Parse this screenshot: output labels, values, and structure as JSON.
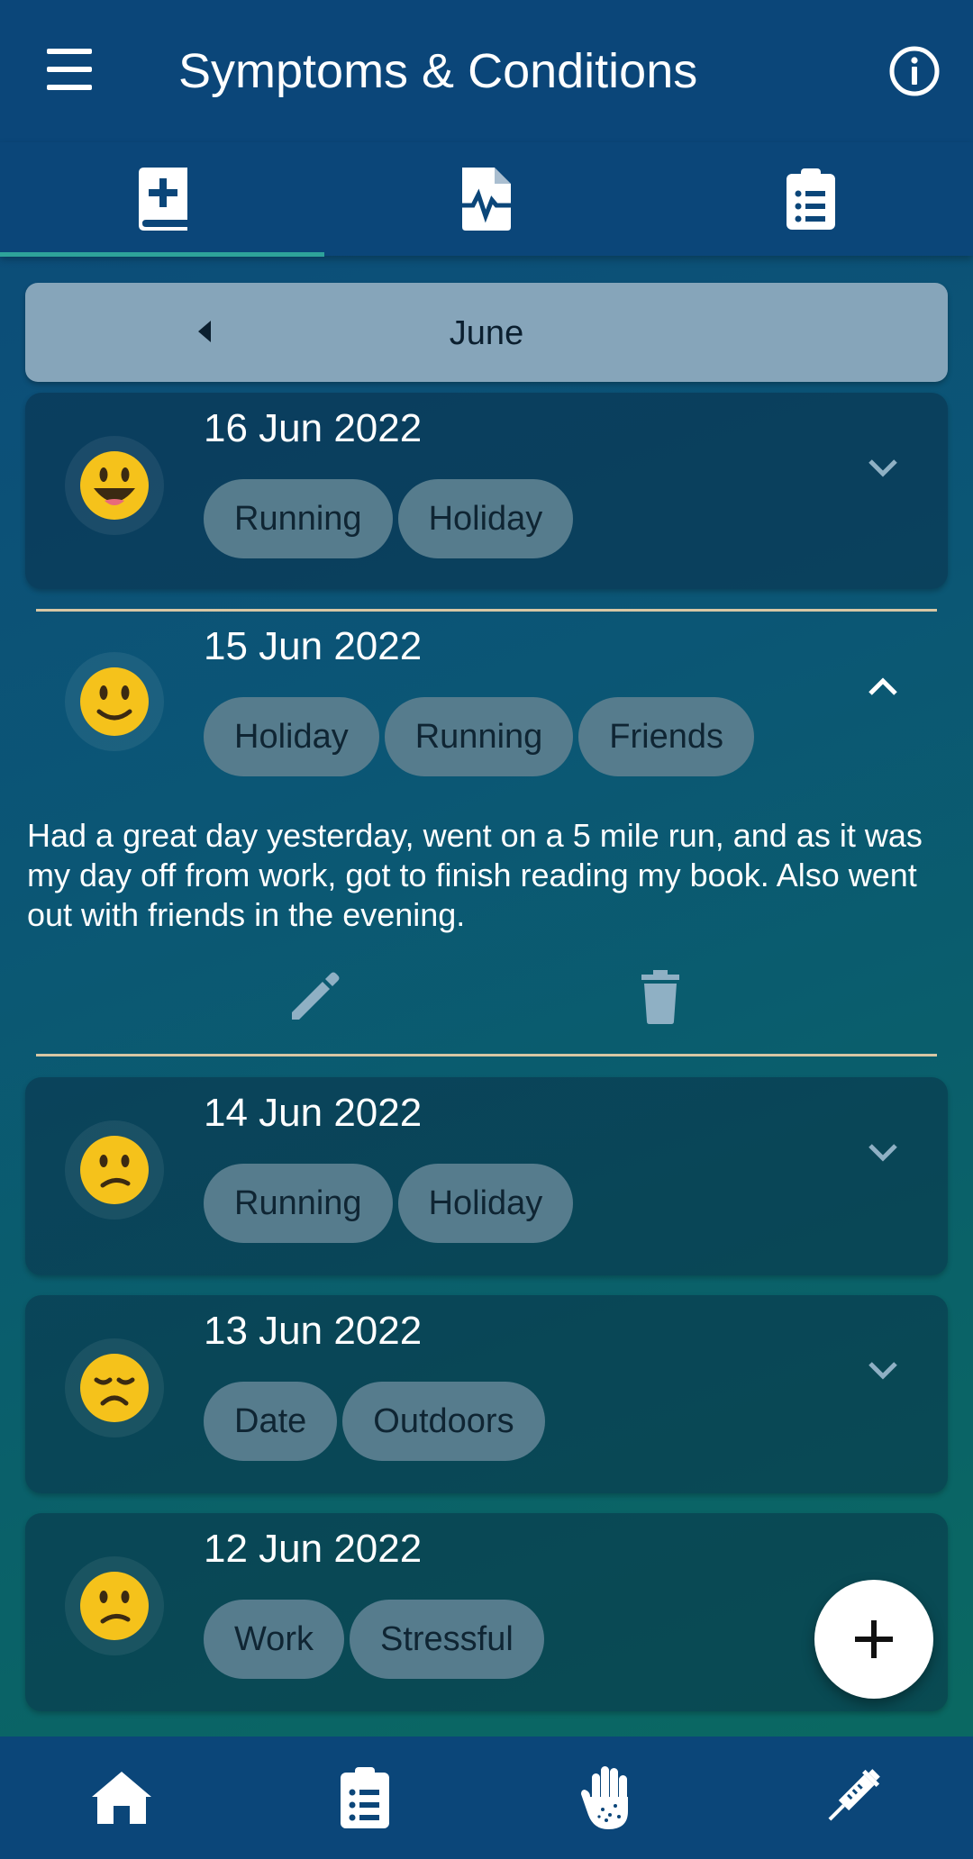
{
  "app": {
    "title": "Symptoms & Conditions"
  },
  "icons": {
    "menu": "menu-icon",
    "info": "info-icon",
    "tabs": [
      "journal-add-icon",
      "medical-file-icon",
      "clipboard-list-icon"
    ],
    "nav": [
      "home-icon",
      "clipboard-list-icon",
      "hand-icon",
      "syringe-icon"
    ]
  },
  "colors": {
    "appbar": "#0b4679",
    "tab_indicator": "#2ea39a",
    "chip": "#567c8d",
    "divider": "#d8c7a4",
    "month_bar": "#86a5ba"
  },
  "month": {
    "label": "June"
  },
  "entries": [
    {
      "date": "16 Jun 2022",
      "mood": "very-happy",
      "tags": [
        "Running",
        "Holiday"
      ],
      "expanded": false
    },
    {
      "date": "15 Jun 2022",
      "mood": "happy",
      "tags": [
        "Holiday",
        "Running",
        "Friends"
      ],
      "expanded": true,
      "note": "Had a great day yesterday, went on a 5 mile run, and as it was my day off from work, got to finish reading my book. Also went out with friends in the evening."
    },
    {
      "date": "14 Jun 2022",
      "mood": "unsure",
      "tags": [
        "Running",
        "Holiday"
      ],
      "expanded": false
    },
    {
      "date": "13 Jun 2022",
      "mood": "sad",
      "tags": [
        "Date",
        "Outdoors"
      ],
      "expanded": false
    },
    {
      "date": "12 Jun 2022",
      "mood": "unsure",
      "tags": [
        "Work",
        "Stressful"
      ],
      "expanded": false
    }
  ]
}
